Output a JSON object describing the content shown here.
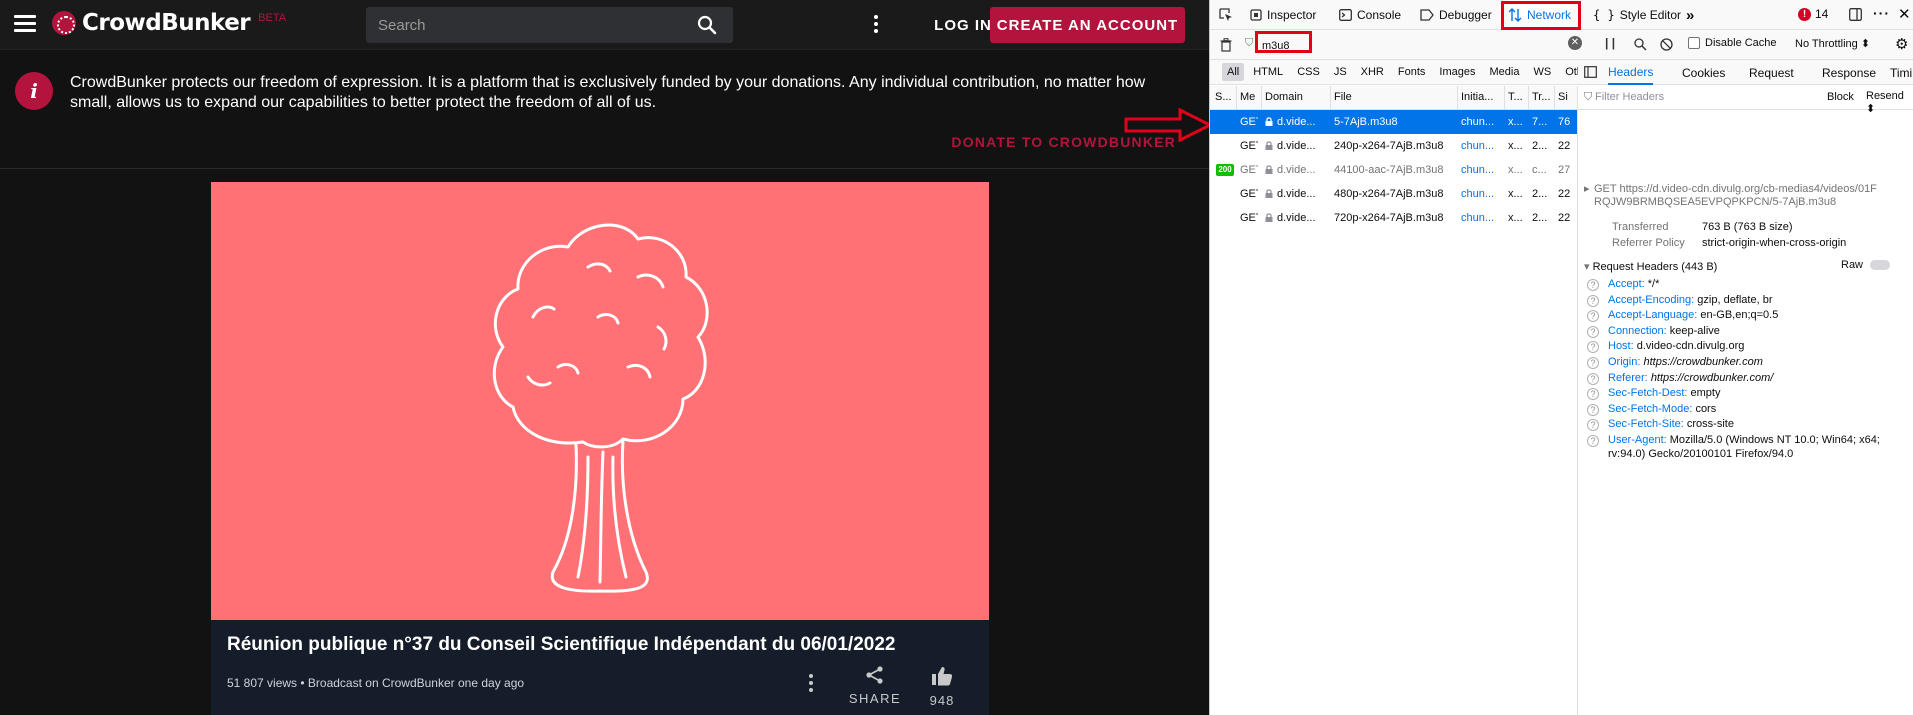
{
  "site": {
    "logo_text": "CrowdBunker",
    "beta_label": "BETA",
    "search_placeholder": "Search",
    "login_label": "LOG IN",
    "create_account_label": "CREATE AN ACCOUNT",
    "notice_icon": "i",
    "notice_text": "CrowdBunker protects our freedom of expression. It is a platform that is exclusively funded by your donations. Any individual contribution, no matter how small, allows us to expand our capabilities to better protect the freedom of all of us.",
    "donate_label": "DONATE TO CROWDBUNKER",
    "video_title": "Réunion publique n°37 du Conseil Scientifique Indépendant du 06/01/2022",
    "video_meta": "51 807 views • Broadcast on CrowdBunker one day ago",
    "share_label": "SHARE",
    "likes_count": "948",
    "colors": {
      "brand": "#b3143d",
      "video_bg": "#ff7175",
      "info_bg": "#141d29"
    }
  },
  "devtools": {
    "tabs": [
      "Inspector",
      "Console",
      "Debugger",
      "Network",
      "Style Editor"
    ],
    "active_tab": "Network",
    "error_count": "14",
    "filter_value": "m3u8",
    "disable_cache_label": "Disable Cache",
    "throttling_label": "No Throttling",
    "type_filters": [
      "All",
      "HTML",
      "CSS",
      "JS",
      "XHR",
      "Fonts",
      "Images",
      "Media",
      "WS",
      "Other"
    ],
    "columns": [
      "S...",
      "Me",
      "Domain",
      "File",
      "Initia...",
      "T...",
      "Tr...",
      "Si"
    ],
    "requests": [
      {
        "status": "",
        "method": "GET",
        "domain": "d.vide...",
        "file": "5-7AjB.m3u8",
        "initiator": "chun...",
        "type": "x...",
        "transferred": "7...",
        "size": "76"
      },
      {
        "status": "",
        "method": "GET",
        "domain": "d.vide...",
        "file": "240p-x264-7AjB.m3u8",
        "initiator": "chun...",
        "type": "x...",
        "transferred": "2...",
        "size": "22"
      },
      {
        "status": "200",
        "method": "GET",
        "domain": "d.vide...",
        "file": "44100-aac-7AjB.m3u8",
        "initiator": "chun...",
        "type": "x...",
        "transferred": "c...",
        "size": "27"
      },
      {
        "status": "",
        "method": "GET",
        "domain": "d.vide...",
        "file": "480p-x264-7AjB.m3u8",
        "initiator": "chun...",
        "type": "x...",
        "transferred": "2...",
        "size": "22"
      },
      {
        "status": "",
        "method": "GET",
        "domain": "d.vide...",
        "file": "720p-x264-7AjB.m3u8",
        "initiator": "chun...",
        "type": "x...",
        "transferred": "2...",
        "size": "22"
      }
    ],
    "side_tabs": [
      "Headers",
      "Cookies",
      "Request",
      "Response",
      "Timi"
    ],
    "filter_headers_placeholder": "Filter Headers",
    "block_label": "Block",
    "resend_label": "Resend",
    "request_method": "GET",
    "request_url_line1": "https://d.video-cdn.divulg.org/cb-medias4/videos/01F",
    "request_url_line2": "RQJW9BRMBQSEA5EVPQPKPCN/5-7AjB.m3u8",
    "transferred_label": "Transferred",
    "transferred_value": "763 B (763 B size)",
    "referrer_policy_label": "Referrer Policy",
    "referrer_policy_value": "strict-origin-when-cross-origin",
    "request_headers_title": "Request Headers (443 B)",
    "raw_label": "Raw",
    "headers": [
      {
        "name": "Accept:",
        "value": "*/*"
      },
      {
        "name": "Accept-Encoding:",
        "value": "gzip, deflate, br"
      },
      {
        "name": "Accept-Language:",
        "value": "en-GB,en;q=0.5"
      },
      {
        "name": "Connection:",
        "value": "keep-alive"
      },
      {
        "name": "Host:",
        "value": "d.video-cdn.divulg.org"
      },
      {
        "name": "Origin:",
        "value": "https://crowdbunker.com"
      },
      {
        "name": "Referer:",
        "value": "https://crowdbunker.com/"
      },
      {
        "name": "Sec-Fetch-Dest:",
        "value": "empty"
      },
      {
        "name": "Sec-Fetch-Mode:",
        "value": "cors"
      },
      {
        "name": "Sec-Fetch-Site:",
        "value": "cross-site"
      },
      {
        "name": "User-Agent:",
        "value": "Mozilla/5.0 (Windows NT 10.0; Win64; x64;"
      }
    ],
    "user_agent_cont": "rv:94.0) Gecko/20100101 Firefox/94.0"
  }
}
